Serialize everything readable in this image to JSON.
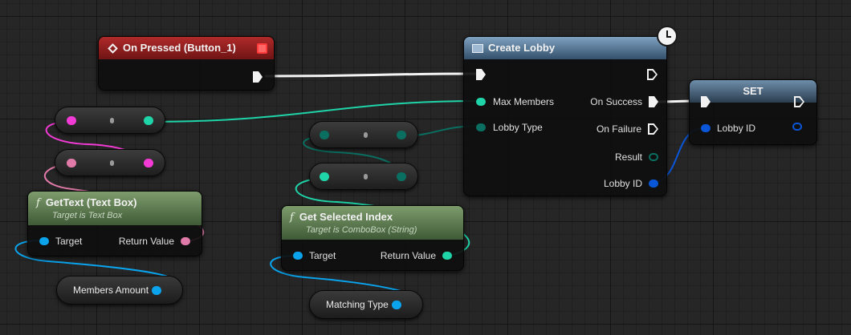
{
  "nodes": {
    "on_pressed": {
      "title": "On Pressed (Button_1)"
    },
    "create_lobby": {
      "title": "Create Lobby",
      "inputs": {
        "max_members": "Max Members",
        "lobby_type": "Lobby Type"
      },
      "outputs": {
        "on_success": "On Success",
        "on_failure": "On Failure",
        "result": "Result",
        "lobby_id": "Lobby ID"
      }
    },
    "set": {
      "title": "SET",
      "input_lobby_id": "Lobby ID"
    },
    "get_text": {
      "title": "GetText (Text Box)",
      "subtitle": "Target is Text Box",
      "target": "Target",
      "return_value": "Return Value"
    },
    "get_selected_index": {
      "title": "Get Selected Index",
      "subtitle": "Target is ComboBox (String)",
      "target": "Target",
      "return_value": "Return Value"
    },
    "members_amount": {
      "label": "Members Amount"
    },
    "matching_type": {
      "label": "Matching Type"
    }
  },
  "colors": {
    "exec": "#f2f2f2",
    "int": "#1fd4a8",
    "enum": "#0a6e60",
    "text": "#e07aa8",
    "object": "#0aa3ec",
    "struct": "#0a56d8",
    "magenta": "#f23ad4"
  }
}
